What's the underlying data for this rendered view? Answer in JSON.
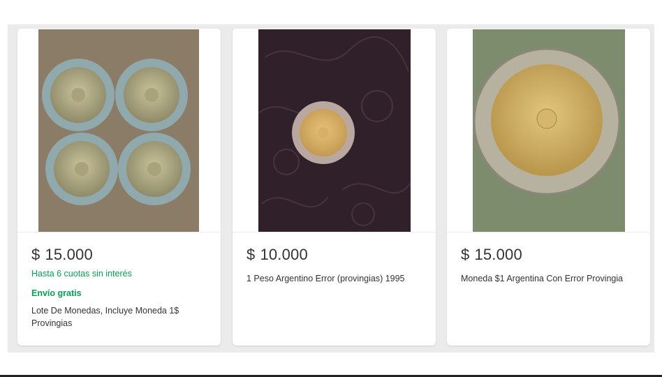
{
  "listings": [
    {
      "price_currency": "$",
      "price_amount": "15.000",
      "installments": "Hasta 6 cuotas sin interés",
      "shipping": "Envío gratis",
      "title": "Lote De Monedas, Incluye Moneda 1$ Provingias"
    },
    {
      "price_currency": "$",
      "price_amount": "10.000",
      "title": "1 Peso Argentino Error (provingias) 1995"
    },
    {
      "price_currency": "$",
      "price_amount": "15.000",
      "title": "Moneda $1 Argentina Con Error Provingia"
    }
  ],
  "colors": {
    "accent_green": "#00a650",
    "panel_bg": "#ebebeb",
    "text": "#333333"
  }
}
